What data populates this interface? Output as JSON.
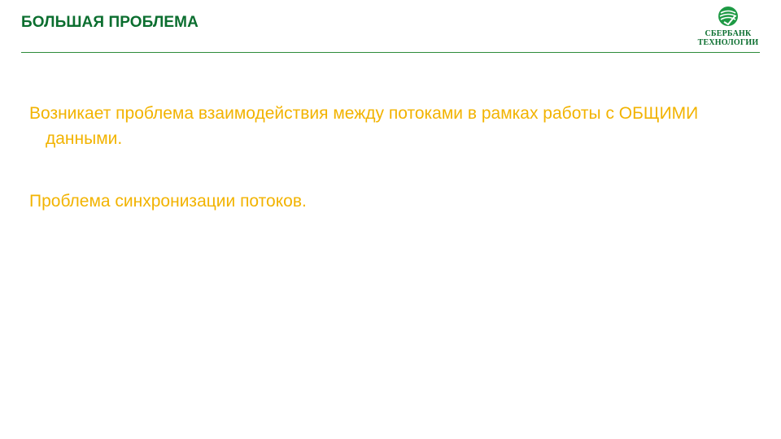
{
  "slide": {
    "title": "БОЛЬШАЯ ПРОБЛЕМА",
    "logo": {
      "icon": "sberbank-logo-icon",
      "line1": "СБЕРБАНК",
      "line2": "ТЕХНОЛОГИИ"
    },
    "paragraphs": [
      "Возникает проблема взаимодействия между потоками в рамках работы с ОБЩИМИ данными.",
      "Проблема синхронизации потоков."
    ]
  },
  "colors": {
    "title": "#0b6e2f",
    "rule": "#2e8b3a",
    "body_text": "#f2b300",
    "logo_green": "#0b6e2f",
    "background": "#ffffff"
  }
}
